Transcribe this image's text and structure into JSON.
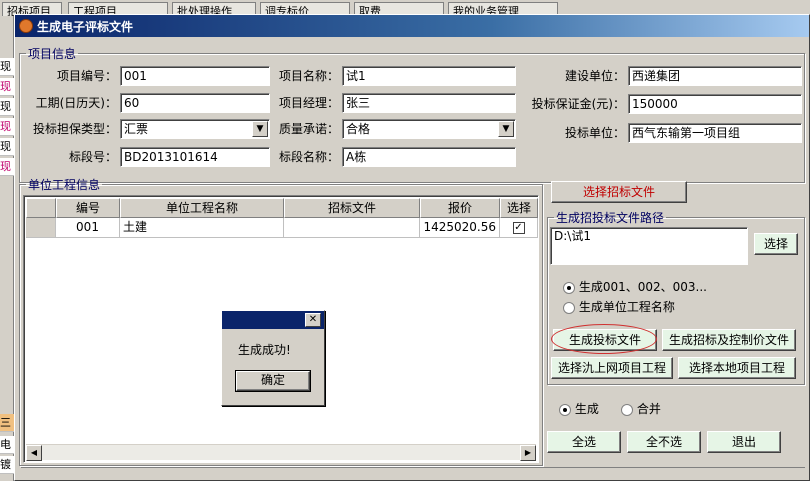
{
  "background": {
    "tabs": [
      "招标项目",
      "工程项目",
      "批处理操作",
      "调专标价",
      "取费",
      "我的业务管理"
    ],
    "left_items": [
      "现",
      "现",
      "现",
      "现",
      "现",
      "现"
    ],
    "left_items_lower": [
      "三",
      "电",
      "镀"
    ]
  },
  "dialog": {
    "title": "生成电子评标文件",
    "project_group_title": "项目信息",
    "fields": {
      "project_no_label": "项目编号：",
      "project_no": "001",
      "project_name_label": "项目名称：",
      "project_name": "试1",
      "build_unit_label": "建设单位：",
      "build_unit": "西递集团",
      "duration_label": "工期(日历天)：",
      "duration": "60",
      "manager_label": "项目经理：",
      "manager": "张三",
      "deposit_label": "投标保证金(元)：",
      "deposit": "150000",
      "guarantee_label": "投标担保类型：",
      "guarantee": "汇票",
      "quality_label": "质量承诺：",
      "quality": "合格",
      "bidder_label": "投标单位：",
      "bidder": "西气东输第一项目组",
      "section_no_label": "标段号：",
      "section_no": "BD2013101614",
      "section_name_label": "标段名称：",
      "section_name": "A栋"
    },
    "unit_group_title": "单位工程信息",
    "table": {
      "headers": [
        "编号",
        "单位工程名称",
        "招标文件",
        "报价",
        "选择"
      ],
      "rows": [
        {
          "no": "001",
          "name": "土建",
          "file": "",
          "price": "1425020.56",
          "checked": "✓"
        }
      ]
    },
    "select_bid_file_button": "选择招标文件",
    "path_group_title": "生成招投标文件路径",
    "path_value": "D:\\试1",
    "path_select_button": "选择",
    "naming_options": [
      "生成001、002、003...",
      "生成单位工程名称"
    ],
    "gen_bid_button": "生成投标文件",
    "gen_control_button": "生成招标及控制价文件",
    "select_online_button": "选择氿上网项目工程",
    "select_local_button": "选择本地项目工程",
    "mode_options": [
      "生成",
      "合并"
    ],
    "select_all_button": "全选",
    "select_none_button": "全不选",
    "exit_button": "退出"
  },
  "message_box": {
    "text": "生成成功!",
    "ok_button": "确定",
    "close_glyph": "✕"
  }
}
